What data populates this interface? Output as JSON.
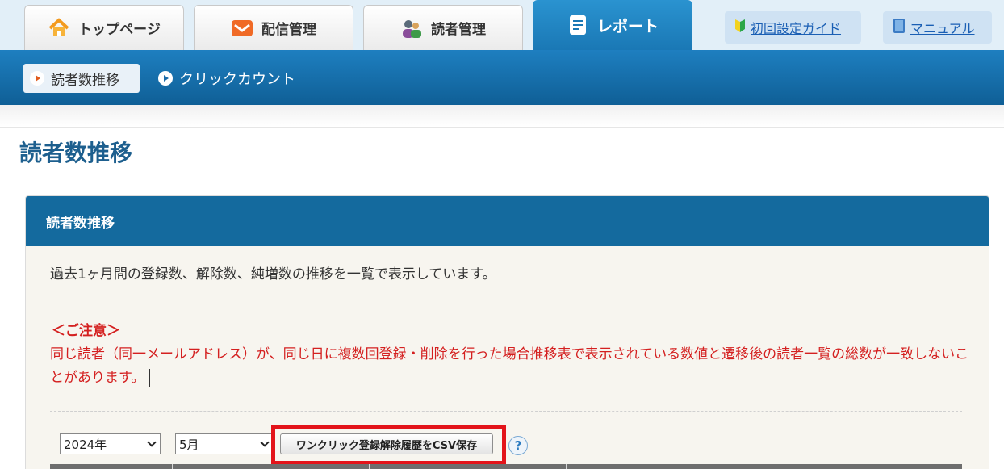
{
  "tabs": [
    {
      "label": "トップページ",
      "icon": "house-icon"
    },
    {
      "label": "配信管理",
      "icon": "envelope-icon"
    },
    {
      "label": "読者管理",
      "icon": "users-icon"
    },
    {
      "label": "レポート",
      "icon": "document-icon",
      "active": true
    }
  ],
  "guides": {
    "setup": "初回設定ガイド",
    "manual": "マニュアル"
  },
  "subnav": {
    "active": "読者数推移",
    "other": "クリックカウント"
  },
  "page_title": "読者数推移",
  "panel": {
    "header": "読者数推移",
    "description": "過去1ヶ月間の登録数、解除数、純増数の推移を一覧で表示しています。",
    "notice_title": "＜ご注意＞",
    "notice_body": "同じ読者（同一メールアドレス）が、同じ日に複数回登録・削除を行った場合推移表で表示されている数値と遷移後の読者一覧の総数が一致しないことがあります。",
    "year_select": "2024年",
    "month_select": "5月",
    "csv_button": "ワンクリック登録解除履歴をCSV保存",
    "help_label": "?"
  },
  "colors": {
    "accent": "#1a78b5",
    "notice": "#d42020",
    "highlight": "#e3141a"
  }
}
